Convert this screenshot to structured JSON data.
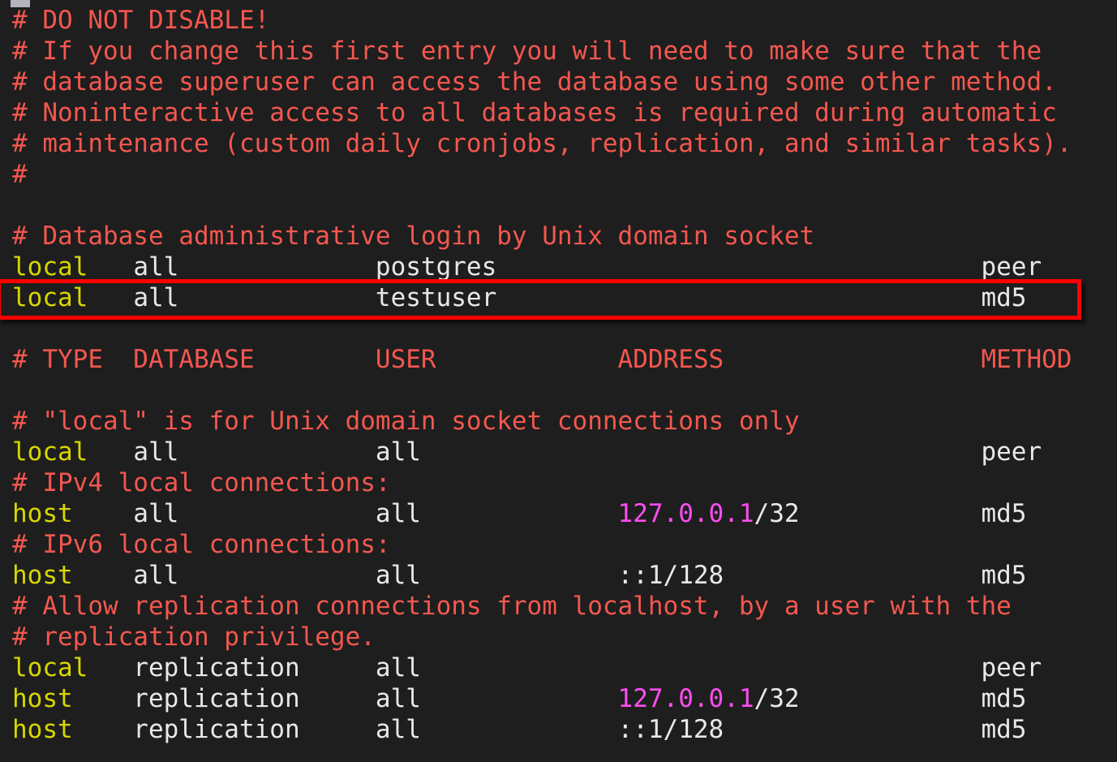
{
  "window": {
    "title": "pg_hba.conf",
    "background_color": "#1e1e1e",
    "artifact_color": "#b3b3bd"
  },
  "colors": {
    "comment": "#f4574f",
    "keyword": "#d7d700",
    "plain": "#e8e8e8",
    "address": "#ff4df0",
    "highlight": "#ff0000",
    "background": "#1e1e1e"
  },
  "highlight": {
    "label": "testuser-rule-highlight",
    "target_line_index": 9,
    "border_color": "#ff0000",
    "border_width_px": 5
  },
  "columns": {
    "type": "TYPE",
    "database": "DATABASE",
    "user": "USER",
    "address": "ADDRESS",
    "method": "METHOD"
  },
  "lines": [
    {
      "index": 0,
      "name": "comment-do-not-disable",
      "segments": [
        {
          "text": "# DO NOT DISABLE!",
          "style": "comment"
        }
      ]
    },
    {
      "index": 1,
      "name": "comment-if-you-change",
      "segments": [
        {
          "text": "# If you change this first entry you will need to make sure that the",
          "style": "comment"
        }
      ]
    },
    {
      "index": 2,
      "name": "comment-database-superuser",
      "segments": [
        {
          "text": "# database superuser can access the database using some other method.",
          "style": "comment"
        }
      ]
    },
    {
      "index": 3,
      "name": "comment-noninteractive",
      "segments": [
        {
          "text": "# Noninteractive access to all databases is required during automatic",
          "style": "comment"
        }
      ]
    },
    {
      "index": 4,
      "name": "comment-maintenance",
      "segments": [
        {
          "text": "# maintenance (custom daily cronjobs, replication, and similar tasks).",
          "style": "comment"
        }
      ]
    },
    {
      "index": 5,
      "name": "comment-hash-only",
      "segments": [
        {
          "text": "#",
          "style": "comment"
        }
      ]
    },
    {
      "index": 6,
      "name": "blank-line-1",
      "segments": [
        {
          "text": " ",
          "style": "blank"
        }
      ]
    },
    {
      "index": 7,
      "name": "comment-db-admin-login",
      "segments": [
        {
          "text": "# Database administrative login by Unix domain socket",
          "style": "comment"
        }
      ]
    },
    {
      "index": 8,
      "name": "rule-local-all-postgres",
      "segments": [
        {
          "text": "local",
          "style": "keyword"
        },
        {
          "text": "   all             postgres                                peer",
          "style": "plain"
        }
      ]
    },
    {
      "index": 9,
      "name": "rule-local-all-testuser",
      "segments": [
        {
          "text": "local",
          "style": "keyword"
        },
        {
          "text": "   all             testuser                                md5",
          "style": "plain"
        }
      ]
    },
    {
      "index": 10,
      "name": "blank-line-2",
      "segments": [
        {
          "text": " ",
          "style": "blank"
        }
      ]
    },
    {
      "index": 11,
      "name": "comment-column-header",
      "segments": [
        {
          "text": "# TYPE  DATABASE        USER            ADDRESS                 METHOD",
          "style": "comment"
        }
      ]
    },
    {
      "index": 12,
      "name": "blank-line-3",
      "segments": [
        {
          "text": " ",
          "style": "blank"
        }
      ]
    },
    {
      "index": 13,
      "name": "comment-local-is-for-unix",
      "segments": [
        {
          "text": "# \"local\" is for Unix domain socket connections only",
          "style": "comment"
        }
      ]
    },
    {
      "index": 14,
      "name": "rule-local-all-all",
      "segments": [
        {
          "text": "local",
          "style": "keyword"
        },
        {
          "text": "   all             all                                     peer",
          "style": "plain"
        }
      ]
    },
    {
      "index": 15,
      "name": "comment-ipv4-local",
      "segments": [
        {
          "text": "# IPv4 local connections:",
          "style": "comment"
        }
      ]
    },
    {
      "index": 16,
      "name": "rule-host-all-all-ipv4",
      "segments": [
        {
          "text": "host",
          "style": "keyword"
        },
        {
          "text": "    all             all             ",
          "style": "plain"
        },
        {
          "text": "127.0.0.1",
          "style": "address"
        },
        {
          "text": "/32            md5",
          "style": "plain"
        }
      ]
    },
    {
      "index": 17,
      "name": "comment-ipv6-local",
      "segments": [
        {
          "text": "# IPv6 local connections:",
          "style": "comment"
        }
      ]
    },
    {
      "index": 18,
      "name": "rule-host-all-all-ipv6",
      "segments": [
        {
          "text": "host",
          "style": "keyword"
        },
        {
          "text": "    all             all             ::1/128                 md5",
          "style": "plain"
        }
      ]
    },
    {
      "index": 19,
      "name": "comment-allow-replication",
      "segments": [
        {
          "text": "# Allow replication connections from localhost, by a user with the",
          "style": "comment"
        }
      ]
    },
    {
      "index": 20,
      "name": "comment-replication-priv",
      "segments": [
        {
          "text": "# replication privilege.",
          "style": "comment"
        }
      ]
    },
    {
      "index": 21,
      "name": "rule-local-replication-all",
      "segments": [
        {
          "text": "local",
          "style": "keyword"
        },
        {
          "text": "   replication     all                                     peer",
          "style": "plain"
        }
      ]
    },
    {
      "index": 22,
      "name": "rule-host-replication-ipv4",
      "segments": [
        {
          "text": "host",
          "style": "keyword"
        },
        {
          "text": "    replication     all             ",
          "style": "plain"
        },
        {
          "text": "127.0.0.1",
          "style": "address"
        },
        {
          "text": "/32            md5",
          "style": "plain"
        }
      ]
    },
    {
      "index": 23,
      "name": "rule-host-replication-ipv6",
      "segments": [
        {
          "text": "host",
          "style": "keyword"
        },
        {
          "text": "    replication     all             ::1/128                 md5",
          "style": "plain"
        }
      ]
    }
  ]
}
